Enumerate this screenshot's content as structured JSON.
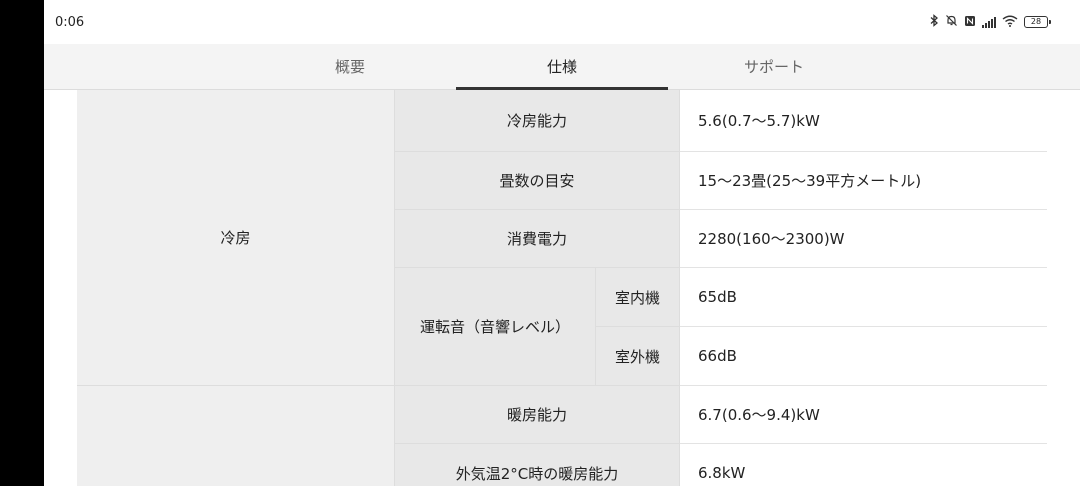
{
  "status_bar": {
    "time": "0:06",
    "icons": [
      "bluetooth-icon",
      "bell-off-icon",
      "nfc-icon",
      "signal-icon",
      "wifi-icon",
      "battery-icon"
    ],
    "battery_level": "28"
  },
  "tabs": [
    {
      "label": "概要",
      "active": false
    },
    {
      "label": "仕様",
      "active": true
    },
    {
      "label": "サポート",
      "active": false
    }
  ],
  "specs": {
    "cooling": {
      "category": "冷房",
      "capacity_label": "冷房能力",
      "capacity_value": "5.6(0.7〜5.7)kW",
      "tatami_label": "畳数の目安",
      "tatami_value": "15〜23畳(25〜39平方メートル)",
      "power_label": "消費電力",
      "power_value": "2280(160〜2300)W",
      "noise_label": "運転音（音響レベル）",
      "indoor_label": "室内機",
      "indoor_value": "65dB",
      "outdoor_label": "室外機",
      "outdoor_value": "66dB"
    },
    "heating": {
      "capacity_label": "暖房能力",
      "capacity_value": "6.7(0.6〜9.4)kW",
      "low_temp_label": "外気温2°C時の暖房能力",
      "low_temp_value": "6.8kW"
    }
  }
}
